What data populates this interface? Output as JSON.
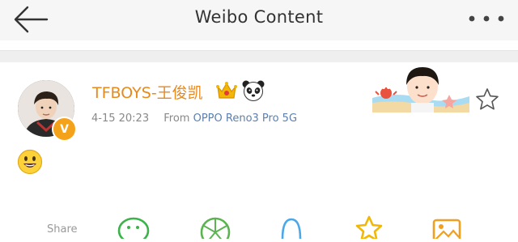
{
  "nav": {
    "title": "Weibo Content",
    "back_icon": "back-arrow-icon",
    "more_icon": "more-dots-icon"
  },
  "post": {
    "author": "TFBOYS-王俊凯",
    "badges": [
      "crown-icon",
      "panda-icon"
    ],
    "verified_mark": "V",
    "timestamp": "4-15 20:23",
    "source_prefix": "From",
    "source_device": "OPPO Reno3 Pro 5G",
    "content_emoji": "smiley-emoji",
    "favorite_icon": "star-outline-icon"
  },
  "share": {
    "label": "Share",
    "icons": [
      "wechat-icon",
      "moments-icon",
      "qq-icon",
      "favorites-star-icon",
      "album-icon"
    ]
  },
  "colors": {
    "author_name": "#e8891c",
    "device_link": "#5b7fae",
    "nav_background": "#f6f6f6",
    "verified_badge": "#f5a21b"
  }
}
